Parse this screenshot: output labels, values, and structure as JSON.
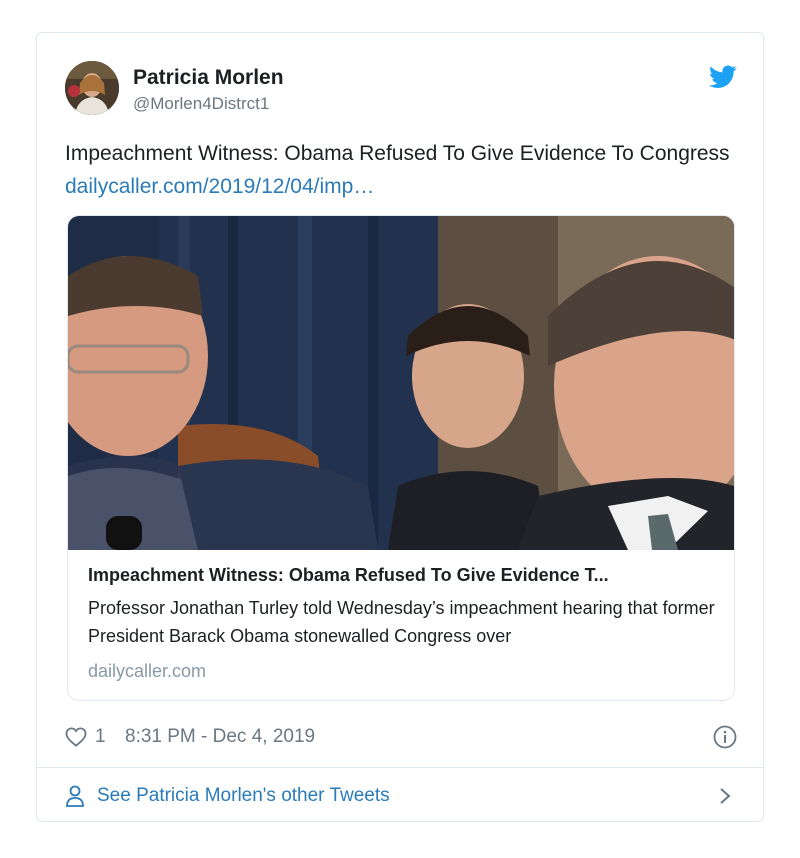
{
  "author": {
    "display_name": "Patricia Morlen",
    "handle": "@Morlen4Distrct1",
    "avatar_icon": "profile-photo"
  },
  "tweet": {
    "text": "Impeachment Witness: Obama Refused To Give Evidence To Congress ",
    "link_text": "dailycaller.com/2019/12/04/imp…"
  },
  "link_card": {
    "title": "Impeachment Witness: Obama Refused To Give Evidence T...",
    "description": "Professor Jonathan Turley told Wednesday’s impeachment hearing that former President Barack Obama stonewalled Congress over",
    "domain": "dailycaller.com"
  },
  "meta": {
    "like_count": "1",
    "timestamp": "8:31 PM - Dec 4, 2019",
    "like_icon": "heart-icon",
    "info_icon": "info-icon"
  },
  "footer": {
    "label": "See Patricia Morlen's other Tweets",
    "icon": "person-icon"
  },
  "colors": {
    "link": "#2b7bb9",
    "twitter_blue": "#1da1f2",
    "muted": "#697882",
    "border": "#e1e8ed"
  }
}
